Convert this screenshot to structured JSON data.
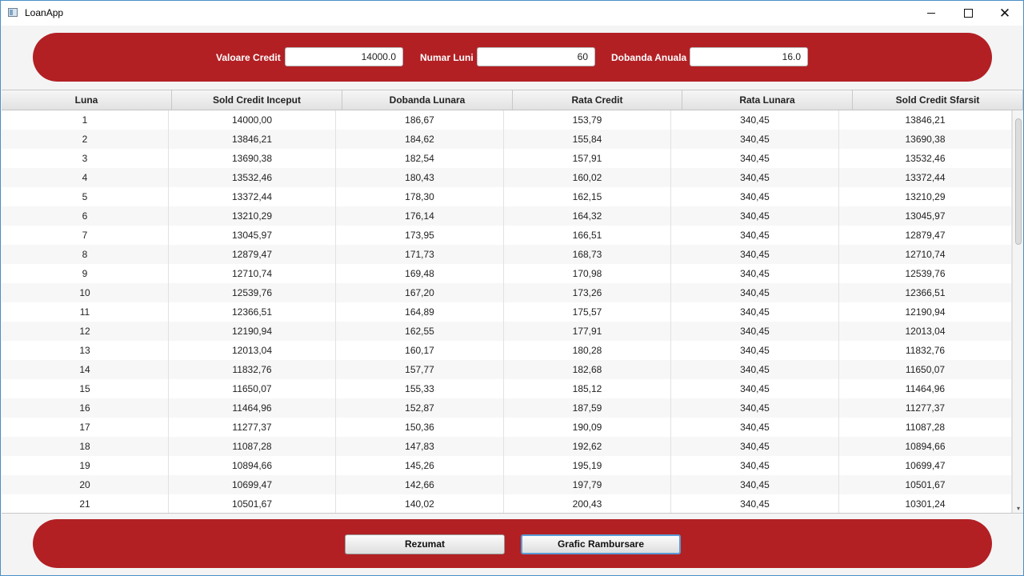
{
  "window": {
    "title": "LoanApp",
    "minimize_icon": "minimize-icon",
    "maximize_icon": "maximize-icon",
    "close_icon": "close-icon",
    "close_glyph": "✕"
  },
  "theme": {
    "accent": "#b22024"
  },
  "inputs": {
    "valoare_credit": {
      "label": "Valoare Credit",
      "value": "14000.0"
    },
    "numar_luni": {
      "label": "Numar Luni",
      "value": "60"
    },
    "dobanda_anuala": {
      "label": "Dobanda Anuala",
      "value": "16.0"
    }
  },
  "table": {
    "columns": [
      "Luna",
      "Sold Credit Inceput",
      "Dobanda Lunara",
      "Rata Credit",
      "Rata Lunara",
      "Sold Credit Sfarsit"
    ],
    "rows": [
      [
        "1",
        "14000,00",
        "186,67",
        "153,79",
        "340,45",
        "13846,21"
      ],
      [
        "2",
        "13846,21",
        "184,62",
        "155,84",
        "340,45",
        "13690,38"
      ],
      [
        "3",
        "13690,38",
        "182,54",
        "157,91",
        "340,45",
        "13532,46"
      ],
      [
        "4",
        "13532,46",
        "180,43",
        "160,02",
        "340,45",
        "13372,44"
      ],
      [
        "5",
        "13372,44",
        "178,30",
        "162,15",
        "340,45",
        "13210,29"
      ],
      [
        "6",
        "13210,29",
        "176,14",
        "164,32",
        "340,45",
        "13045,97"
      ],
      [
        "7",
        "13045,97",
        "173,95",
        "166,51",
        "340,45",
        "12879,47"
      ],
      [
        "8",
        "12879,47",
        "171,73",
        "168,73",
        "340,45",
        "12710,74"
      ],
      [
        "9",
        "12710,74",
        "169,48",
        "170,98",
        "340,45",
        "12539,76"
      ],
      [
        "10",
        "12539,76",
        "167,20",
        "173,26",
        "340,45",
        "12366,51"
      ],
      [
        "11",
        "12366,51",
        "164,89",
        "175,57",
        "340,45",
        "12190,94"
      ],
      [
        "12",
        "12190,94",
        "162,55",
        "177,91",
        "340,45",
        "12013,04"
      ],
      [
        "13",
        "12013,04",
        "160,17",
        "180,28",
        "340,45",
        "11832,76"
      ],
      [
        "14",
        "11832,76",
        "157,77",
        "182,68",
        "340,45",
        "11650,07"
      ],
      [
        "15",
        "11650,07",
        "155,33",
        "185,12",
        "340,45",
        "11464,96"
      ],
      [
        "16",
        "11464,96",
        "152,87",
        "187,59",
        "340,45",
        "11277,37"
      ],
      [
        "17",
        "11277,37",
        "150,36",
        "190,09",
        "340,45",
        "11087,28"
      ],
      [
        "18",
        "11087,28",
        "147,83",
        "192,62",
        "340,45",
        "10894,66"
      ],
      [
        "19",
        "10894,66",
        "145,26",
        "195,19",
        "340,45",
        "10699,47"
      ],
      [
        "20",
        "10699,47",
        "142,66",
        "197,79",
        "340,45",
        "10501,67"
      ],
      [
        "21",
        "10501,67",
        "140,02",
        "200,43",
        "340,45",
        "10301,24"
      ]
    ]
  },
  "buttons": {
    "rezumat": "Rezumat",
    "grafic": "Grafic Rambursare"
  }
}
